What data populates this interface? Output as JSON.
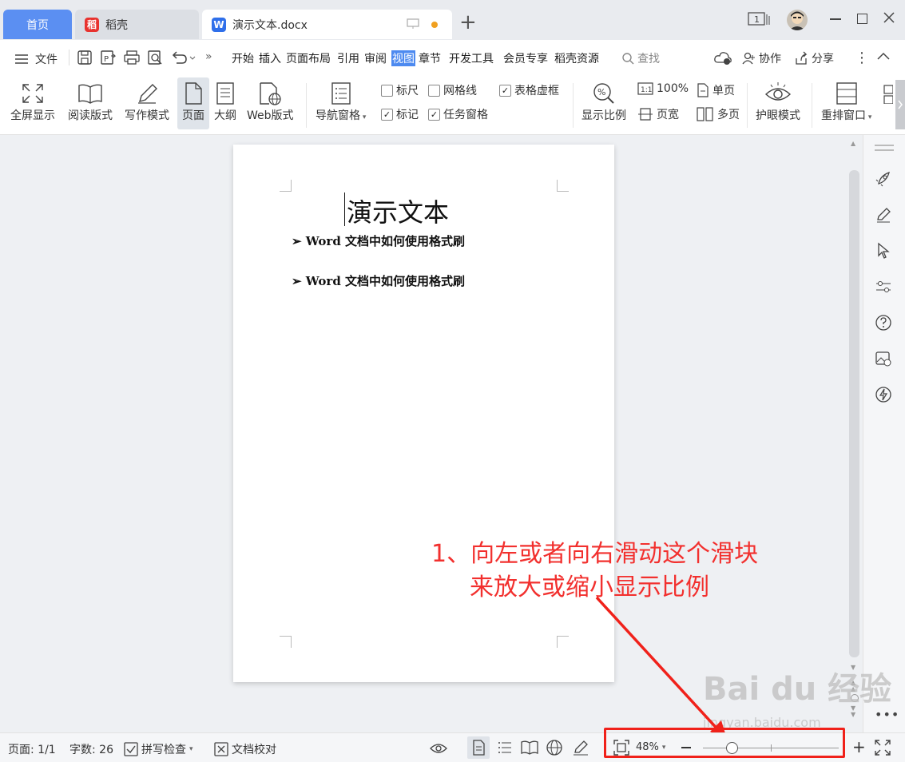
{
  "tabs": {
    "home": "首页",
    "daoke": "稻壳",
    "doc": "演示文本.docx",
    "add": "+"
  },
  "menu": {
    "file": "文件",
    "items": [
      "开始",
      "插入",
      "页面布局",
      "引用",
      "审阅",
      "视图",
      "章节",
      "开发工具",
      "会员专享",
      "稻壳资源"
    ],
    "active": "视图",
    "search": "查找",
    "collab": "协作",
    "share": "分享"
  },
  "ribbon": {
    "fullscreen": "全屏显示",
    "reading": "阅读版式",
    "writing": "写作模式",
    "page": "页面",
    "outline": "大纲",
    "web": "Web版式",
    "nav_pane": "导航窗格",
    "ruler": "标尺",
    "gridlines": "网格线",
    "table_borders": "表格虚框",
    "marks": "标记",
    "task_pane": "任务窗格",
    "zoom_ratio": "显示比例",
    "hundred": "100%",
    "page_width": "页宽",
    "single_page": "单页",
    "multi_page": "多页",
    "eye_mode": "护眼模式",
    "rearrange": "重排窗口"
  },
  "document": {
    "title": "演示文本",
    "bullets": [
      "Word 文档中如何使用格式刷",
      "Word 文档中如何使用格式刷"
    ]
  },
  "status": {
    "page": "页面: 1/1",
    "words": "字数: 26",
    "spellcheck": "拼写检查",
    "proofread": "文档校对",
    "zoom": "48%",
    "zoom_level": 0.48
  },
  "annotation": {
    "line1": "1、向左或者向右滑动这个滑块",
    "line2": "来放大或缩小显示比例"
  },
  "watermark": {
    "text": "Bai du 经验",
    "sub": "jingyan.baidu.com"
  },
  "colors": {
    "accent": "#4d8af0",
    "annotation": "#f2302e"
  }
}
